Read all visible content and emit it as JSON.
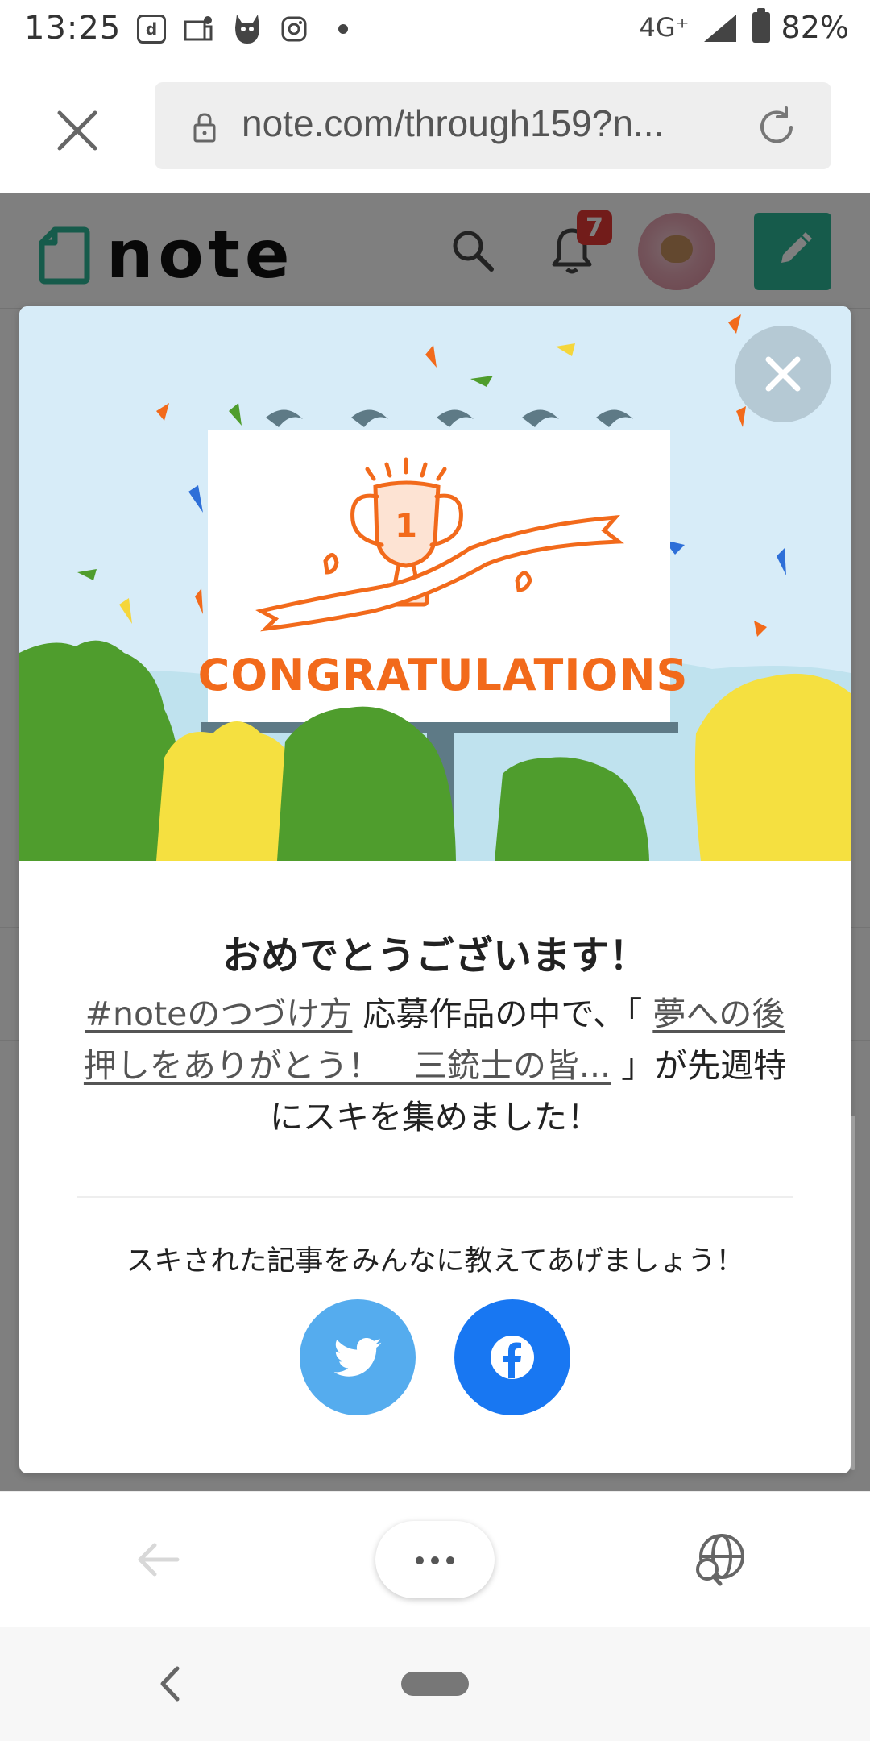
{
  "status_bar": {
    "time": "13:25",
    "icons": [
      "docomo-d-icon",
      "news-icon",
      "animal-app-icon",
      "instagram-icon"
    ],
    "network": "4G⁺",
    "battery": "82%"
  },
  "browser": {
    "url": "note.com/through159?n...",
    "close_icon": "close-icon",
    "lock_icon": "lock-icon",
    "reload_icon": "reload-icon"
  },
  "note_header": {
    "logo_text": "note",
    "notification_count": "7",
    "brand_color": "#2cb696"
  },
  "modal": {
    "illustration_text": "CONGRATULATIONS",
    "trophy_number": "1",
    "title": "おめでとうございます！",
    "body": {
      "hashtag_link": "#noteのつづけ方",
      "text_1": " 応募作品の中で、「 ",
      "article_link": "夢への後押しをありがとう！　三銃士の皆...",
      "text_2": " 」が先週特にスキを集めました！"
    },
    "share_prompt": "スキされた記事をみんなに教えてあげましょう！",
    "share_buttons": [
      {
        "name": "twitter",
        "color": "#55acee"
      },
      {
        "name": "facebook",
        "color": "#1877f2"
      }
    ]
  },
  "bottom_bar": {
    "back_icon": "arrow-left-icon",
    "more_icon": "more-dots-icon",
    "translate_icon": "globe-search-icon"
  },
  "nav_bar": {
    "back_icon": "chevron-left-icon",
    "home_icon": "home-pill-icon"
  }
}
